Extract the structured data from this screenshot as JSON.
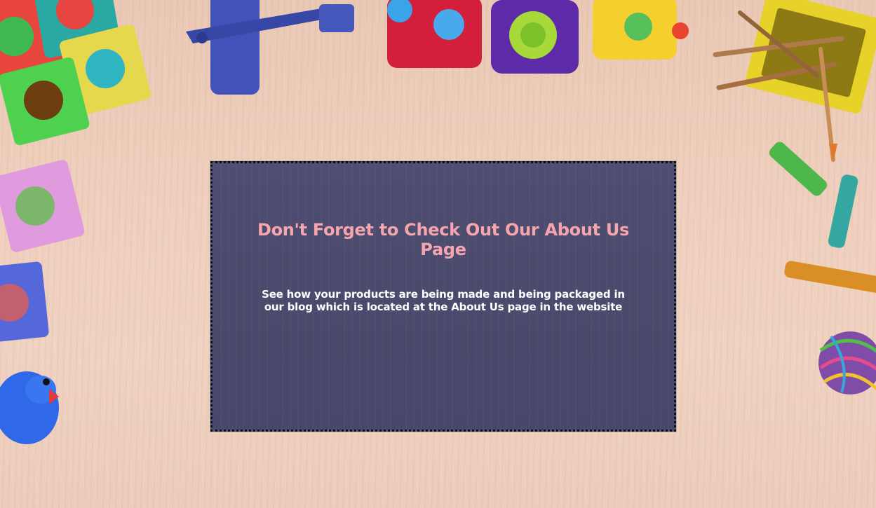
{
  "promo": {
    "title": "Don't Forget to Check Out Our About Us Page",
    "body": "See how your products are being made and being packaged in our blog which is located at the About Us page in the website"
  },
  "background": {
    "theme": "wooden-desk-with-toys",
    "colors": {
      "wood": "#efcfbd",
      "card": "#4a4a6c",
      "title": "#f6a5ae",
      "body_text": "#ffffff"
    },
    "decorations": [
      "foam-puzzle-icon",
      "toy-airplane-icon",
      "toy-train-icon",
      "pencil-holder-icon",
      "crayon-icon",
      "yarn-ball-icon",
      "rubber-duck-icon"
    ]
  }
}
